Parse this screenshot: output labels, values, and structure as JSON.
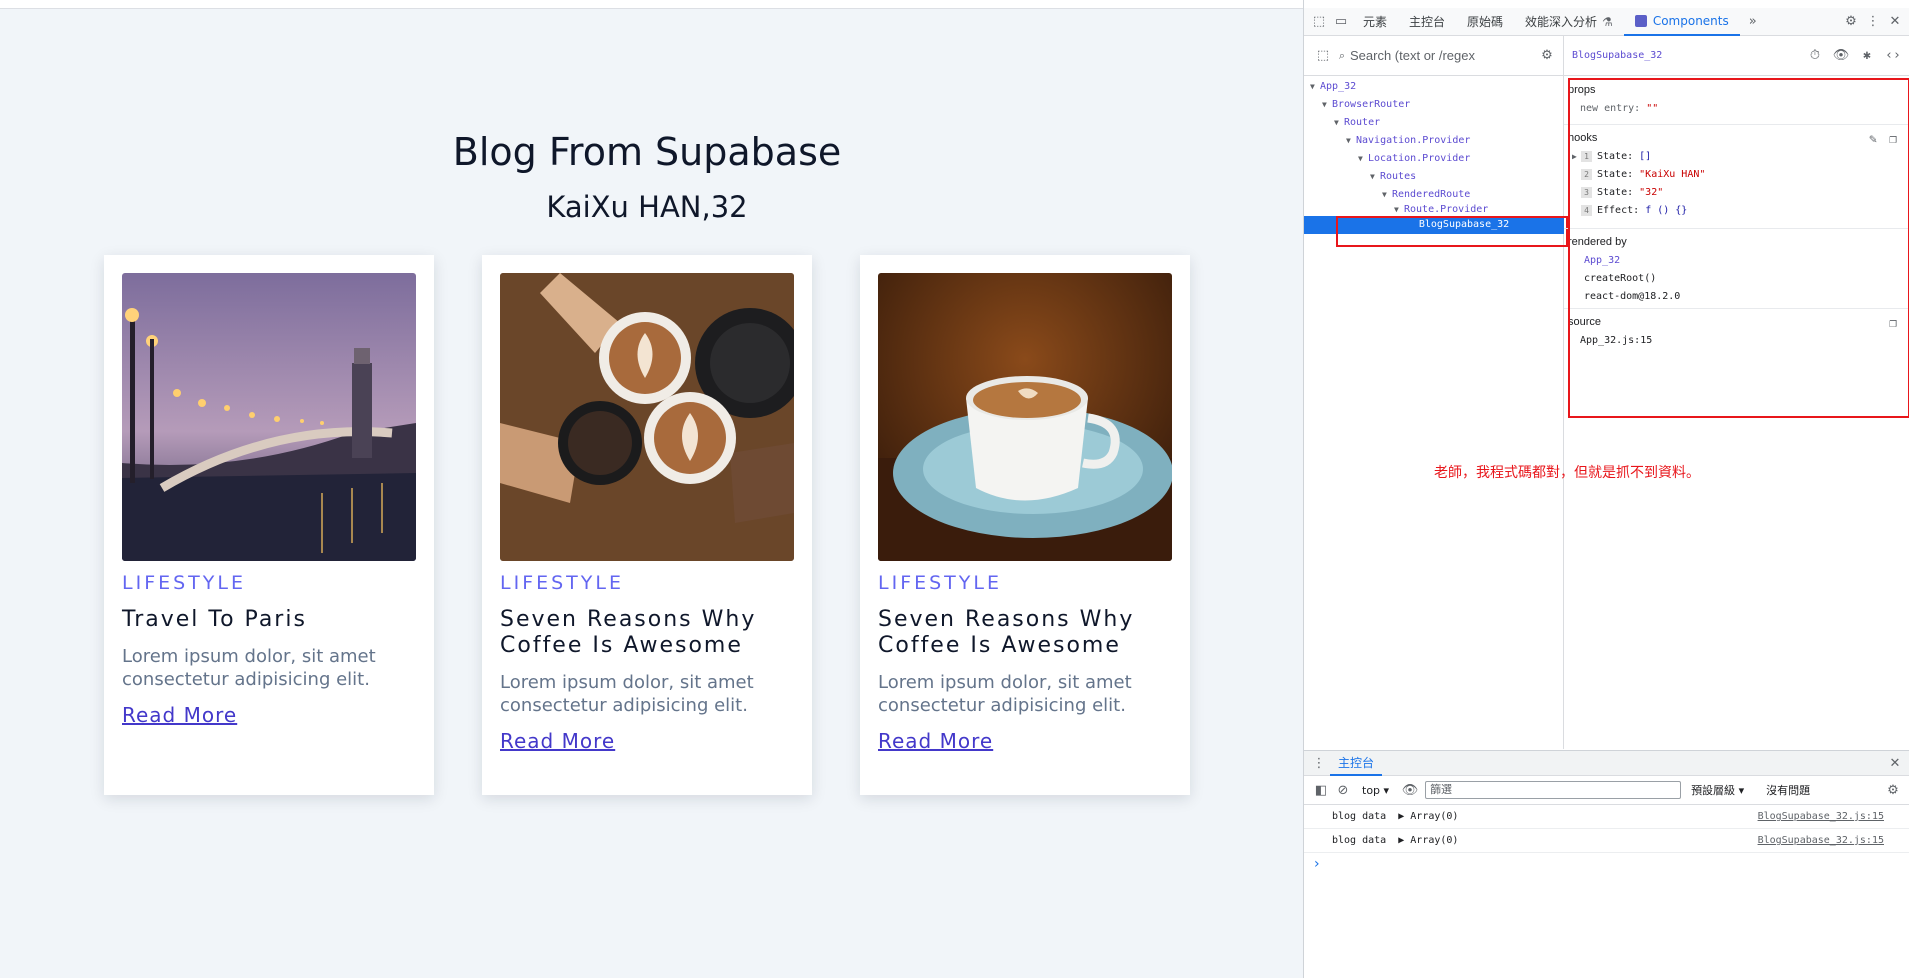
{
  "blog": {
    "title": "Blog From Supabase",
    "author": "KaiXu HAN,32",
    "cards": [
      {
        "category": "LIFESTYLE",
        "title": "Travel To Paris",
        "description": "Lorem ipsum dolor, sit amet consectetur adipisicing elit.",
        "link": "Read More"
      },
      {
        "category": "LIFESTYLE",
        "title": "Seven Reasons Why Coffee Is Awesome",
        "description": "Lorem ipsum dolor, sit amet consectetur adipisicing elit.",
        "link": "Read More"
      },
      {
        "category": "LIFESTYLE",
        "title": "Seven Reasons Why Coffee Is Awesome",
        "description": "Lorem ipsum dolor, sit amet consectetur adipisicing elit.",
        "link": "Read More"
      }
    ]
  },
  "devtools": {
    "tabs": [
      "元素",
      "主控台",
      "原始碼",
      "效能深入分析"
    ],
    "active_tab": "Components",
    "search_placeholder": "Search (text or /regex",
    "tree": [
      {
        "label": "App_32"
      },
      {
        "label": "BrowserRouter"
      },
      {
        "label": "Router"
      },
      {
        "label": "Navigation.Provider"
      },
      {
        "label": "Location.Provider"
      },
      {
        "label": "Routes"
      },
      {
        "label": "RenderedRoute"
      },
      {
        "label": "Route.Provider"
      },
      {
        "label": "BlogSupabase_32"
      }
    ],
    "inspector": {
      "component": "BlogSupabase_32",
      "props_heading": "props",
      "prop_key": "new entry:",
      "prop_value": "\"\"",
      "hooks_heading": "hooks",
      "hooks": [
        {
          "idx": "1",
          "name": "State:",
          "value": "[]"
        },
        {
          "idx": "2",
          "name": "State:",
          "value": "\"KaiXu HAN\""
        },
        {
          "idx": "3",
          "name": "State:",
          "value": "\"32\""
        },
        {
          "idx": "4",
          "name": "Effect:",
          "value": "f () {}"
        }
      ],
      "rendered_heading": "rendered by",
      "rendered_by": [
        "App_32",
        "createRoot()",
        "react-dom@18.2.0"
      ],
      "source_heading": "source",
      "source": "App_32.js:15"
    },
    "note": "老師，我程式碼都對，但就是抓不到資料。",
    "console": {
      "tab": "主控台",
      "context": "top",
      "filter_placeholder": "篩選",
      "level": "預設層級",
      "issues": "沒有問題",
      "logs": [
        {
          "label": "blog data",
          "value": "Array(0)",
          "source": "BlogSupabase_32.js:15"
        },
        {
          "label": "blog data",
          "value": "Array(0)",
          "source": "BlogSupabase_32.js:15"
        }
      ],
      "prompt": "›"
    }
  }
}
